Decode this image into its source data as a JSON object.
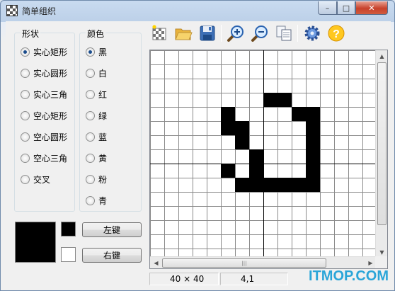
{
  "window": {
    "title": "简单组织",
    "min_symbol": "–",
    "max_symbol": "□",
    "close_symbol": "✕"
  },
  "shape_group": {
    "title": "形状",
    "options": [
      "实心矩形",
      "实心圆形",
      "实心三角",
      "空心矩形",
      "空心圆形",
      "空心三角",
      "交叉"
    ],
    "selected": 0
  },
  "color_group": {
    "title": "颜色",
    "options": [
      "黑",
      "白",
      "红",
      "绿",
      "蓝",
      "黄",
      "粉",
      "青"
    ],
    "selected": 0
  },
  "mouse": {
    "left_button_label": "左键",
    "right_button_label": "右键",
    "left_color": "#000000",
    "right_color": "#ffffff"
  },
  "toolbar": [
    "new-icon",
    "open-folder-icon",
    "save-icon",
    "zoom-in-icon",
    "zoom-out-icon",
    "copy-icon",
    "settings-gear-icon",
    "help-icon"
  ],
  "canvas": {
    "filled_cells": [
      [
        8,
        3
      ],
      [
        9,
        3
      ],
      [
        5,
        4
      ],
      [
        10,
        4
      ],
      [
        11,
        4
      ],
      [
        5,
        5
      ],
      [
        6,
        5
      ],
      [
        11,
        5
      ],
      [
        6,
        6
      ],
      [
        11,
        6
      ],
      [
        7,
        7
      ],
      [
        11,
        7
      ],
      [
        5,
        8
      ],
      [
        7,
        8
      ],
      [
        11,
        8
      ],
      [
        6,
        9
      ],
      [
        7,
        9
      ],
      [
        8,
        9
      ],
      [
        9,
        9
      ],
      [
        10,
        9
      ],
      [
        11,
        9
      ]
    ]
  },
  "status": {
    "size": "40 × 40",
    "coord": "4,1"
  },
  "watermark": "ITMOP.COM"
}
